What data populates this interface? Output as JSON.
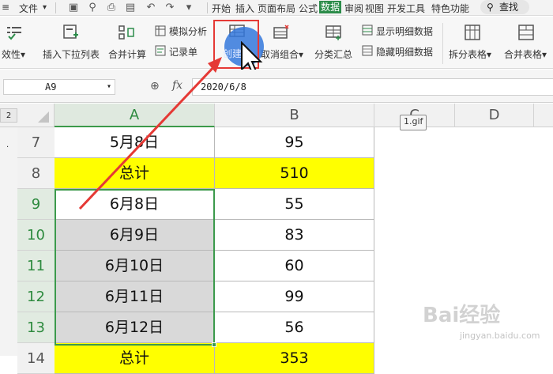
{
  "menu": {
    "file": "文件",
    "tabs": [
      "开始",
      "插入",
      "页面布局",
      "公式",
      "数据",
      "审阅",
      "视图",
      "开发工具",
      "特色功能"
    ],
    "active_tab": "数据",
    "search": "查找"
  },
  "ribbon": {
    "validity": "效性",
    "insert_dropdown": "插入下拉列表",
    "merge_calc": "合并计算",
    "sim_analysis": "模拟分析",
    "record": "记录单",
    "create_group": "创建",
    "ungroup": "取消组合",
    "subtotal": "分类汇总",
    "show_detail": "显示明细数据",
    "hide_detail": "隐藏明细数据",
    "split_table": "拆分表格",
    "merge_table": "合并表格"
  },
  "formula_bar": {
    "cell_ref": "A9",
    "fx": "fx",
    "value": "2020/6/8"
  },
  "outline_level": "2",
  "columns": [
    "A",
    "B",
    "C",
    "D"
  ],
  "rows": [
    {
      "num": "7",
      "a": "5月8日",
      "b": "95",
      "type": "normal"
    },
    {
      "num": "8",
      "a": "总计",
      "b": "510",
      "type": "total"
    },
    {
      "num": "9",
      "a": "6月8日",
      "b": "55",
      "type": "active"
    },
    {
      "num": "10",
      "a": "6月9日",
      "b": "83",
      "type": "selected"
    },
    {
      "num": "11",
      "a": "6月10日",
      "b": "60",
      "type": "selected"
    },
    {
      "num": "12",
      "a": "6月11日",
      "b": "99",
      "type": "selected"
    },
    {
      "num": "13",
      "a": "6月12日",
      "b": "56",
      "type": "selected"
    },
    {
      "num": "14",
      "a": "总计",
      "b": "353",
      "type": "total"
    }
  ],
  "tooltip": "1.gif",
  "watermark": {
    "main": "Bai经验",
    "sub": "jingyan.baidu.com"
  },
  "colors": {
    "accent": "#2c8c4a",
    "highlight": "#e53935",
    "total": "#ffff00"
  }
}
